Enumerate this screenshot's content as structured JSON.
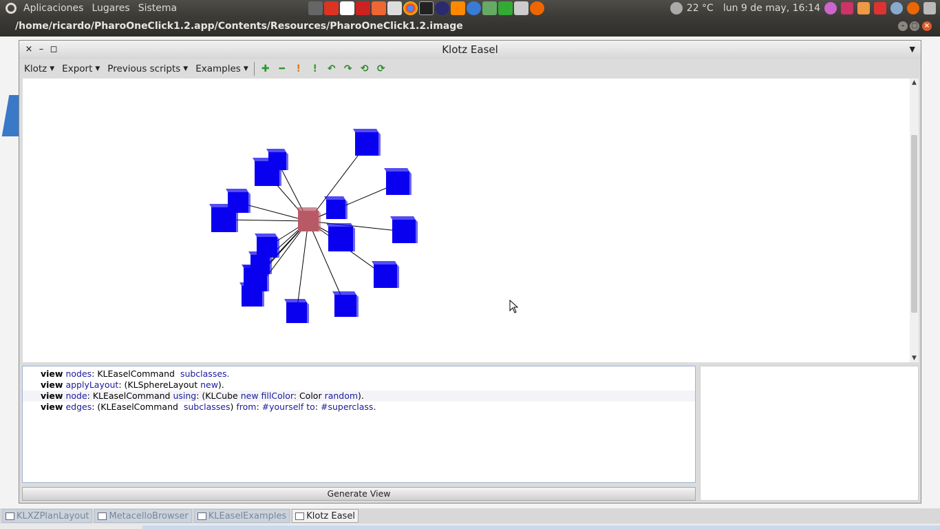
{
  "top_panel": {
    "menus": [
      "Aplicaciones",
      "Lugares",
      "Sistema"
    ],
    "temperature": "22 °C",
    "datetime": "lun  9 de may, 16:14"
  },
  "outer_window": {
    "title": "/home/ricardo/PharoOneClick1.2.app/Contents/Resources/PharoOneClick1.2.image"
  },
  "easel": {
    "title": "Klotz Easel",
    "toolbar_menus": [
      "Klotz",
      "Export",
      "Previous scripts",
      "Examples"
    ],
    "toolbar_icons": [
      "zoom-in-icon",
      "zoom-out-icon",
      "move-up-icon",
      "move-down-icon",
      "rotate-left-icon",
      "rotate-right-icon",
      "pan-left-icon",
      "pan-right-icon"
    ],
    "graph": {
      "center_color": "#b85a66",
      "node_color": "#0a00f0",
      "node_count": 17
    },
    "script_lines": [
      [
        {
          "t": "view",
          "c": "kw"
        },
        {
          "t": " nodes",
          "c": "sel"
        },
        {
          "t": ": KLEaselCommand  ",
          "c": "plain"
        },
        {
          "t": "subclasses.",
          "c": "sel"
        }
      ],
      [
        {
          "t": "view",
          "c": "kw"
        },
        {
          "t": " applyLayout",
          "c": "sel"
        },
        {
          "t": ": (KLSphereLayout ",
          "c": "plain"
        },
        {
          "t": "new",
          "c": "sel"
        },
        {
          "t": ").",
          "c": "plain"
        }
      ],
      [
        {
          "t": "view",
          "c": "kw"
        },
        {
          "t": " node",
          "c": "sel"
        },
        {
          "t": ": KLEaselCommand ",
          "c": "plain"
        },
        {
          "t": "using",
          "c": "sel"
        },
        {
          "t": ": (KLCube ",
          "c": "plain"
        },
        {
          "t": "new",
          "c": "sel"
        },
        {
          "t": " fillColor",
          "c": "sel"
        },
        {
          "t": ": Color ",
          "c": "plain"
        },
        {
          "t": "random",
          "c": "sel"
        },
        {
          "t": ").",
          "c": "plain"
        }
      ],
      [
        {
          "t": "view",
          "c": "kw"
        },
        {
          "t": " edges",
          "c": "sel"
        },
        {
          "t": ": (KLEaselCommand  ",
          "c": "plain"
        },
        {
          "t": "subclasses",
          "c": "sel"
        },
        {
          "t": ") ",
          "c": "plain"
        },
        {
          "t": "from",
          "c": "sel"
        },
        {
          "t": ": ",
          "c": "plain"
        },
        {
          "t": "#yourself",
          "c": "sel"
        },
        {
          "t": " to",
          "c": "sel"
        },
        {
          "t": ": ",
          "c": "plain"
        },
        {
          "t": "#superclass",
          "c": "sel"
        },
        {
          "t": ".",
          "c": "plain"
        }
      ]
    ],
    "generate_button": "Generate View"
  },
  "taskbar": {
    "items": [
      {
        "label": "KLXZPlanLayout",
        "active": false
      },
      {
        "label": "MetacelloBrowser",
        "active": false
      },
      {
        "label": "KLEaselExamples",
        "active": false
      },
      {
        "label": "Klotz Easel",
        "active": true
      }
    ]
  }
}
